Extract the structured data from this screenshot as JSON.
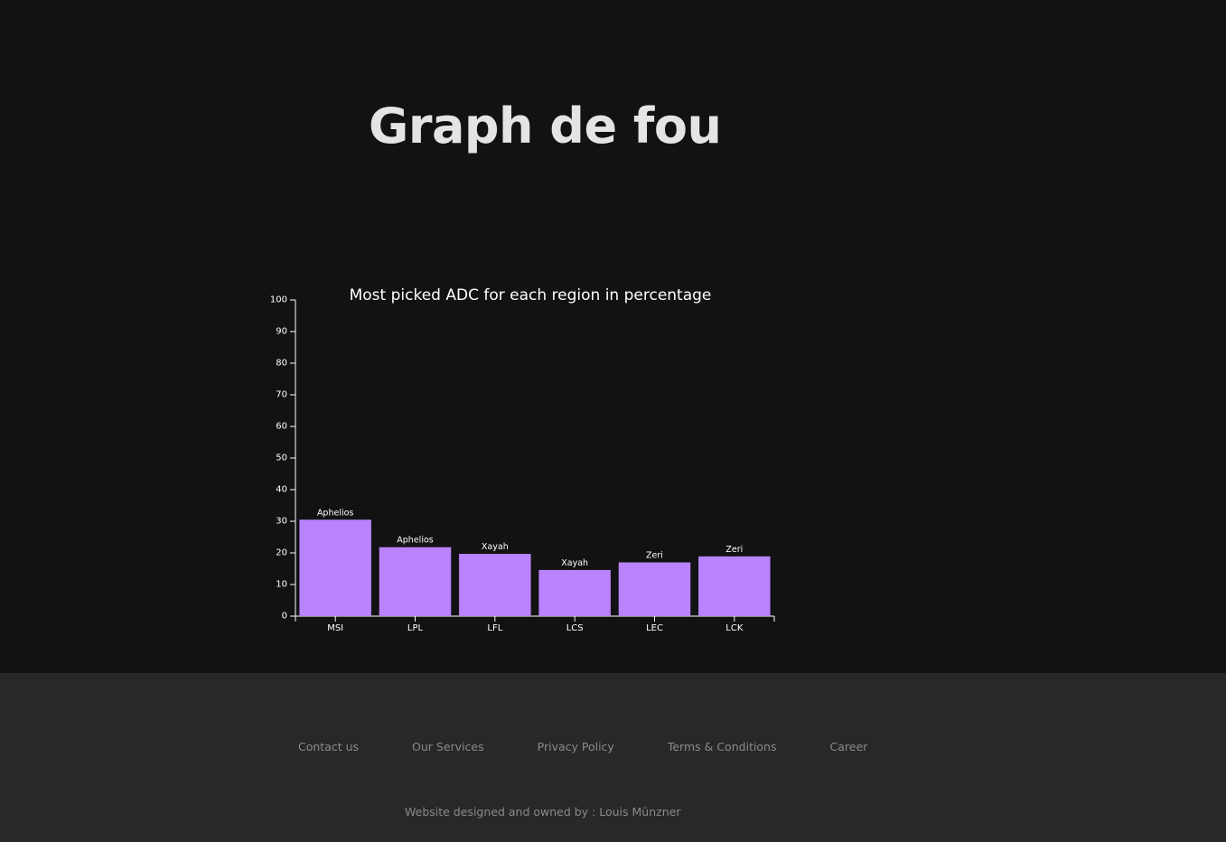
{
  "page": {
    "title": "Graph de fou"
  },
  "chart_data": {
    "type": "bar",
    "title": "Most picked ADC for each region in percentage",
    "xlabel": "",
    "ylabel": "",
    "categories": [
      "MSI",
      "LPL",
      "LFL",
      "LCS",
      "LEC",
      "LCK"
    ],
    "values": [
      30.5,
      21.8,
      19.7,
      14.6,
      17.0,
      18.9
    ],
    "bar_labels": [
      "Aphelios",
      "Aphelios",
      "Xayah",
      "Xayah",
      "Zeri",
      "Zeri"
    ],
    "ylim": [
      0,
      100
    ],
    "yticks": [
      0,
      10,
      20,
      30,
      40,
      50,
      60,
      70,
      80,
      90,
      100
    ],
    "grid": false,
    "colors": {
      "bar": "#b983fc",
      "text": "#ffffff",
      "axis": "#ffffff"
    }
  },
  "footer": {
    "links": [
      "Contact us",
      "Our Services",
      "Privacy Policy",
      "Terms & Conditions",
      "Career"
    ],
    "credit": "Website designed and owned by : Louis Münzner"
  }
}
